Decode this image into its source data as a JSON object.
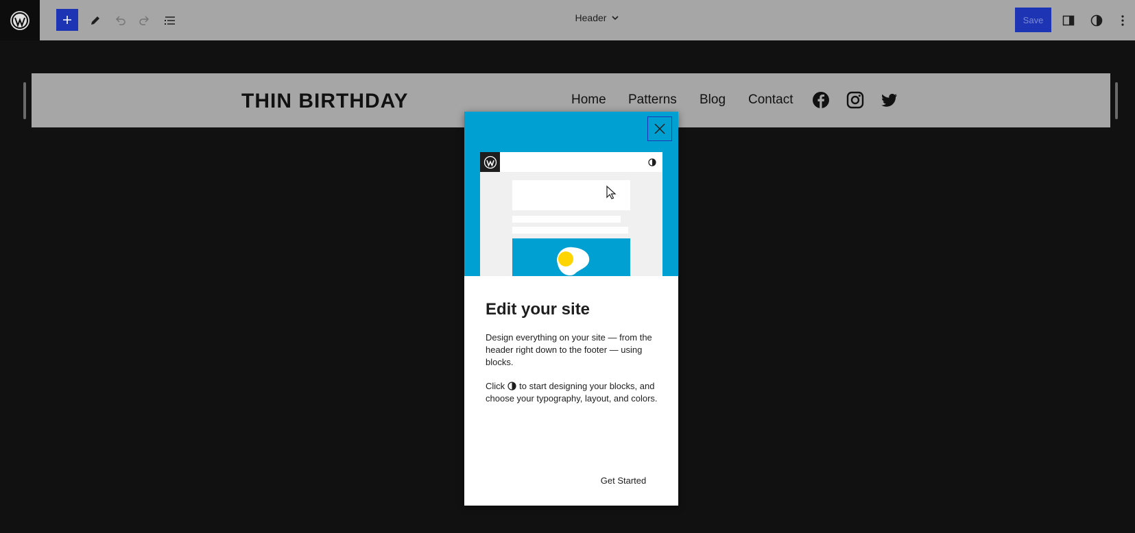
{
  "toolbar": {
    "document_title": "Header",
    "save_label": "Save",
    "icons": [
      "wordpress-icon",
      "plus-icon",
      "pencil-icon",
      "undo-icon",
      "redo-icon",
      "list-view-icon",
      "chevron-down-icon",
      "sidebar-icon",
      "styles-icon",
      "more-vertical-icon"
    ]
  },
  "canvas": {
    "site_title": "THIN BIRTHDAY",
    "nav_items": [
      "Home",
      "Patterns",
      "Blog",
      "Contact"
    ],
    "social_icons": [
      "facebook-icon",
      "instagram-icon",
      "twitter-icon"
    ]
  },
  "modal": {
    "heading": "Edit your site",
    "paragraph1": "Design everything on your site — from the header right down to the footer — using blocks.",
    "paragraph2_before": "Click",
    "paragraph2_after": "to start designing your blocks, and choose your typography, layout, and colors.",
    "cta_label": "Get Started"
  },
  "colors": {
    "accent": "#1d35b4",
    "hero": "#00a0d2",
    "topbar": "#a6a6a6",
    "canvas_bg": "#111111"
  }
}
